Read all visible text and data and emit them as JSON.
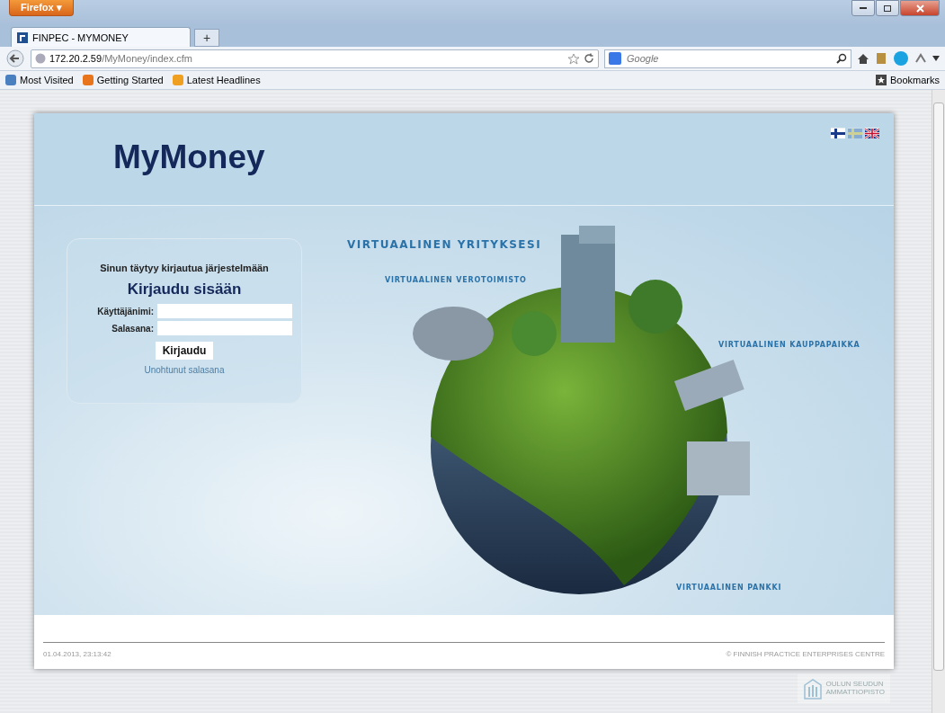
{
  "browser": {
    "menu_button": "Firefox ▾",
    "tab": {
      "title": "FINPEC - MYMONEY",
      "selected": true
    },
    "new_tab": "+",
    "address": {
      "host": "172.20.2.59",
      "path": "/MyMoney/index.cfm"
    },
    "search": {
      "placeholder": "Google"
    },
    "bookmarks": [
      "Most Visited",
      "Getting Started",
      "Latest Headlines"
    ],
    "bookmarks_menu": "Bookmarks"
  },
  "page": {
    "logo": "MyMoney",
    "languages": [
      {
        "kind": "fi",
        "selected": true
      },
      {
        "kind": "sv",
        "selected": false
      },
      {
        "kind": "en",
        "selected": true
      }
    ],
    "login": {
      "notice": "Sinun täytyy kirjautua järjestelmään",
      "heading": "Kirjaudu sisään",
      "fields": [
        {
          "label": "Käyttäjänimi:"
        },
        {
          "label": "Salasana:"
        }
      ],
      "submit": "Kirjaudu",
      "forgot_link": "Unohtunut salasana"
    },
    "illustration_labels": [
      {
        "text": "VIRTUAALINEN YRITYKSESI",
        "kind": "heading"
      },
      {
        "text": "VIRTUAALINEN VEROTOIMISTO",
        "kind": "caption"
      },
      {
        "text": "VIRTUAALINEN KAUPPAPAIKKA",
        "kind": "caption"
      },
      {
        "text": "VIRTUAALINEN PANKKI",
        "kind": "caption"
      }
    ],
    "footer": {
      "timestamp": "01.04.2013, 23:13:42",
      "copyright": "© FINNISH PRACTICE ENTERPRISES CENTRE"
    },
    "sponsor": [
      "OULUN SEUDUN",
      "AMMATTIOPISTO"
    ]
  }
}
